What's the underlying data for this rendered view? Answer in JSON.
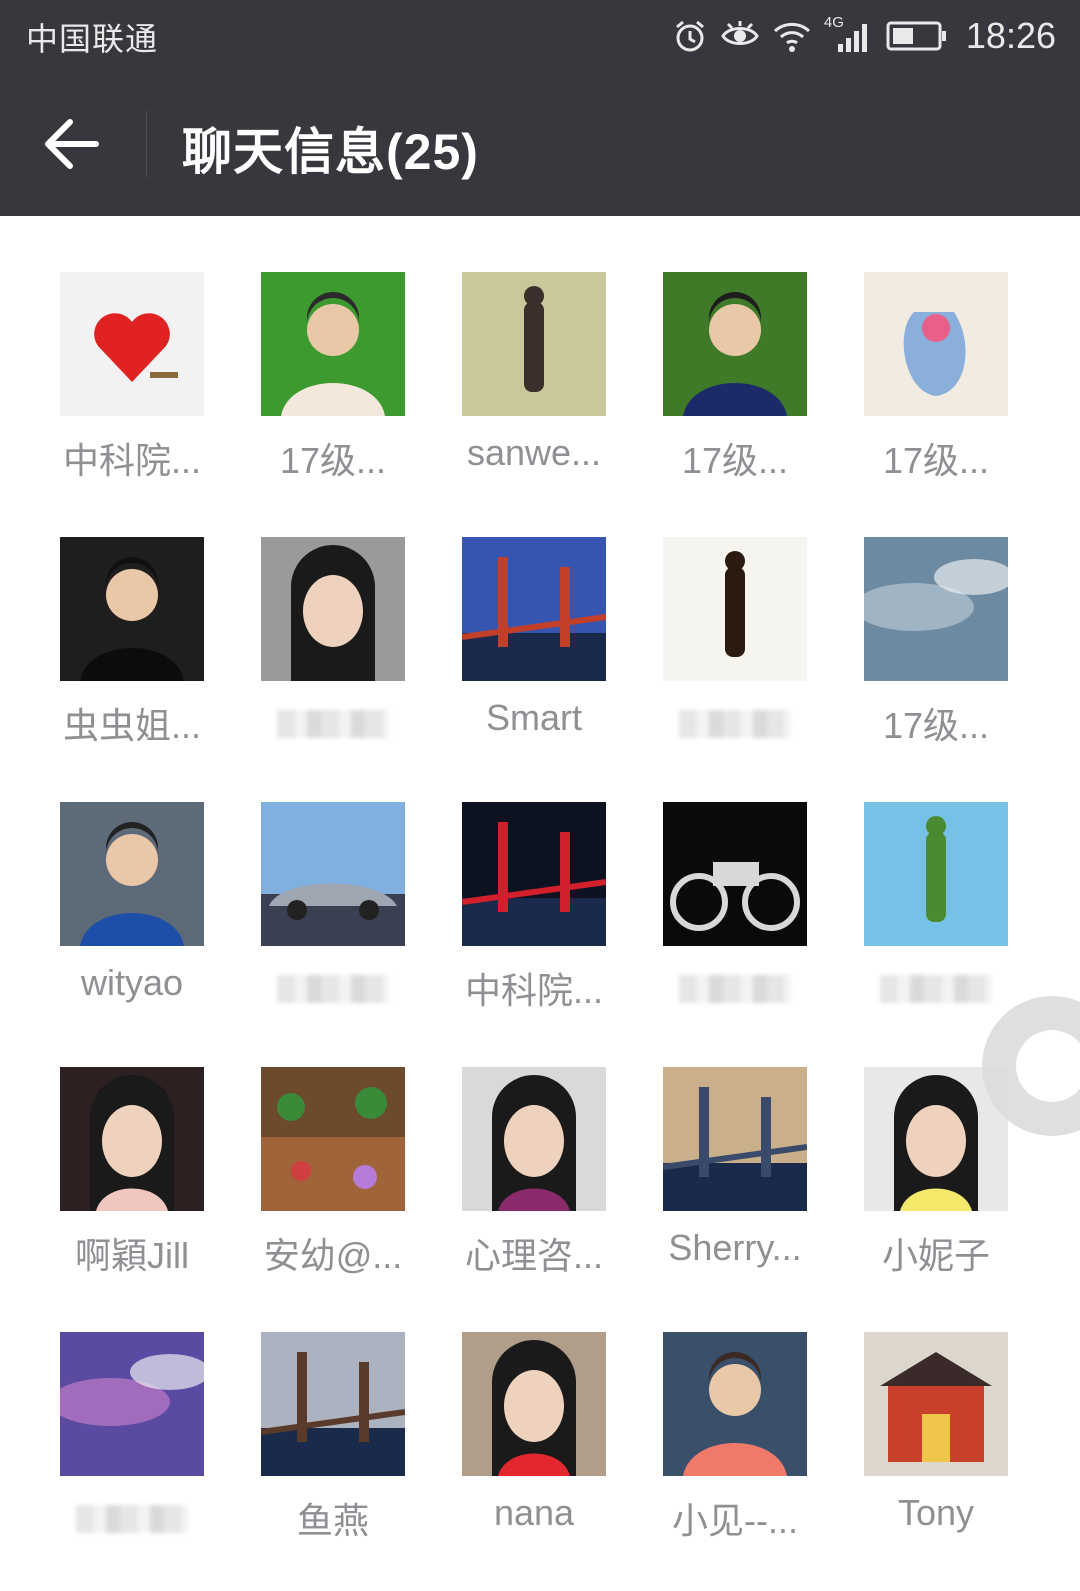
{
  "status_bar": {
    "carrier": "中国联通",
    "network": "4G",
    "time": "18:26"
  },
  "header": {
    "title": "聊天信息",
    "count": "(25)",
    "back_icon": "arrow-left-icon"
  },
  "members": [
    {
      "name": "中科院..."
    },
    {
      "name": "17级..."
    },
    {
      "name": "sanwe..."
    },
    {
      "name": "17级..."
    },
    {
      "name": "17级..."
    },
    {
      "name": "虫虫姐..."
    },
    {
      "name": ""
    },
    {
      "name": "Smart"
    },
    {
      "name": ""
    },
    {
      "name": "17级..."
    },
    {
      "name": "wityao"
    },
    {
      "name": ""
    },
    {
      "name": "中科院..."
    },
    {
      "name": ""
    },
    {
      "name": ""
    },
    {
      "name": "啊穎Jill"
    },
    {
      "name": "安幼@..."
    },
    {
      "name": "心理咨..."
    },
    {
      "name": "Sherry..."
    },
    {
      "name": "小妮子"
    },
    {
      "name": ""
    },
    {
      "name": "鱼燕"
    },
    {
      "name": "nana"
    },
    {
      "name": "小见--..."
    },
    {
      "name": "Tony"
    }
  ],
  "colors": {
    "header_bg": "#37373d",
    "name_text": "#8f8f94"
  }
}
